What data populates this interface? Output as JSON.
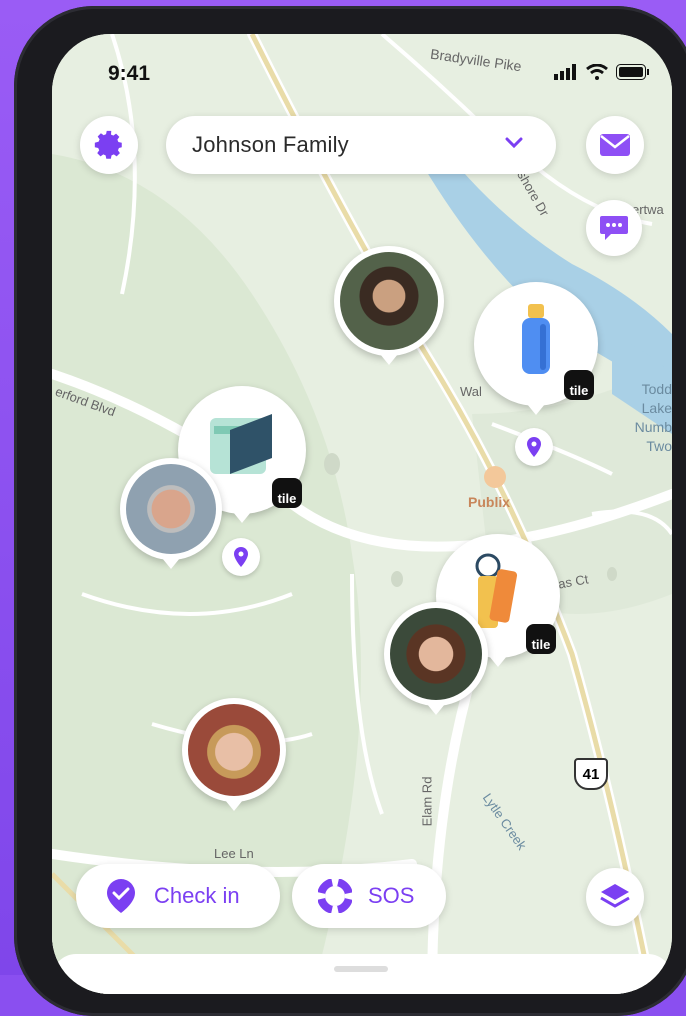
{
  "status": {
    "time": "9:41"
  },
  "header": {
    "group_name": "Johnson Family"
  },
  "map_labels": {
    "bradyville": "Bradyville Pike",
    "lakeshore": "keshore Dr",
    "hertford": "erford Blvd",
    "walnut": "Wal",
    "publix": "Publix",
    "todd_lake": "Todd Lake Numb Two",
    "thomas_ct": "as Ct",
    "lee_ln": "Lee Ln",
    "elam_rd": "Elam Rd",
    "lytle_creek": "Lytle Creek",
    "route": "41",
    "partial_north": "ertwa"
  },
  "tile_badge": "tile",
  "actions": {
    "check_in": "Check in",
    "sos": "SOS"
  },
  "colors": {
    "accent": "#7b3ff2",
    "background": "#8a4ff0"
  }
}
